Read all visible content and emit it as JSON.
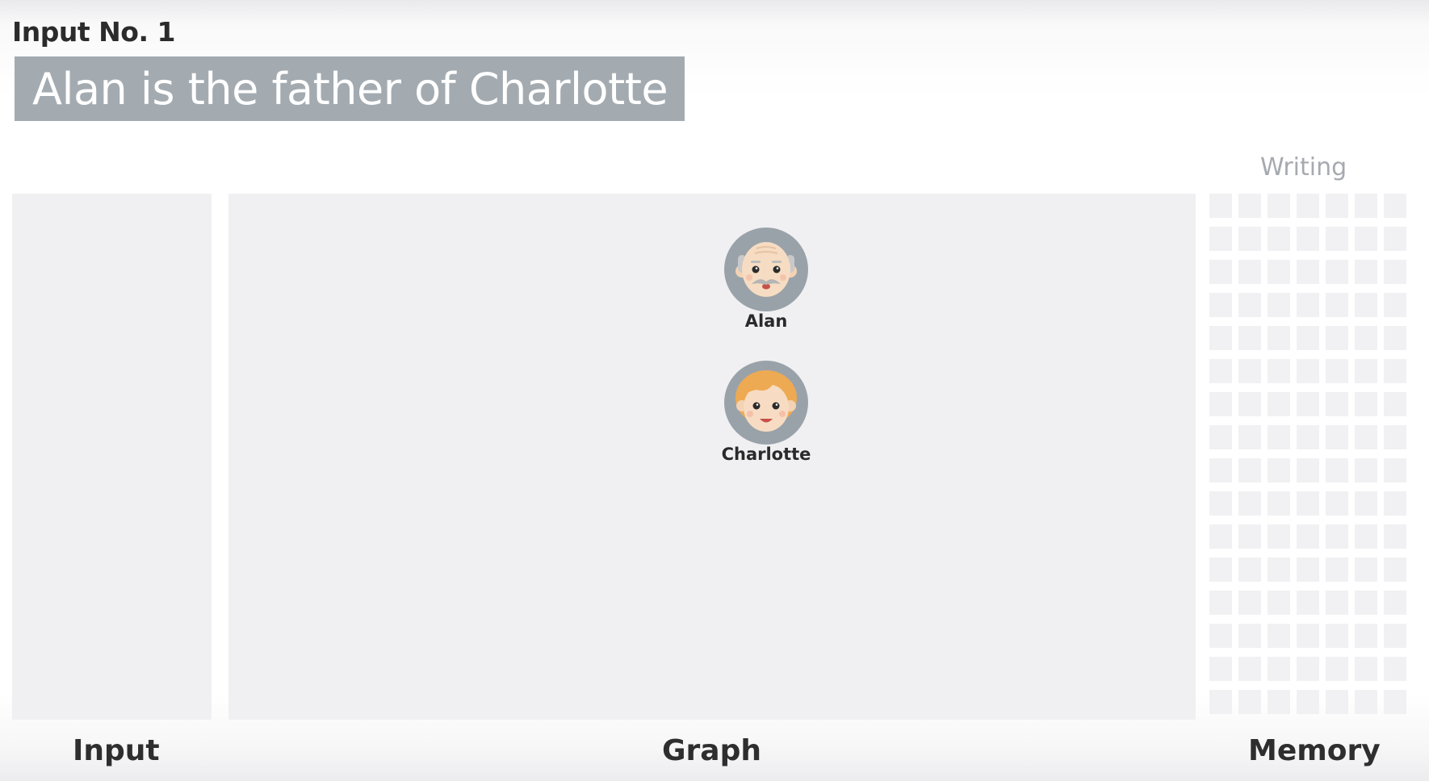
{
  "header": {
    "input_number": "Input No. 1",
    "sentence": "Alan is the father of Charlotte"
  },
  "memory": {
    "status": "Writing",
    "rows": 16,
    "columns": 7
  },
  "graph": {
    "nodes": [
      {
        "name": "Alan",
        "icon": "old-man-avatar-icon"
      },
      {
        "name": "Charlotte",
        "icon": "girl-avatar-icon"
      }
    ]
  },
  "sections": {
    "input": "Input",
    "graph": "Graph",
    "memory": "Memory"
  },
  "colors": {
    "sentence_bg": "#a3abb1",
    "panel_bg": "#f0f0f2",
    "avatar_ring": "#9aa2a9",
    "status_text": "#a6aab0"
  }
}
